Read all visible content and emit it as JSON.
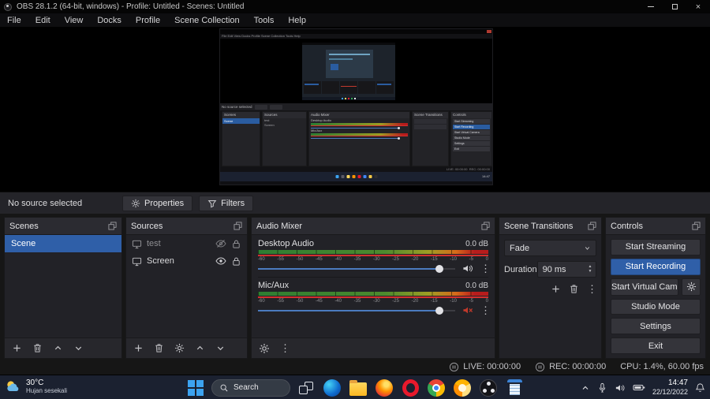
{
  "window": {
    "title": "OBS 28.1.2 (64-bit, windows) - Profile: Untitled - Scenes: Untitled"
  },
  "menu": {
    "items": [
      "File",
      "Edit",
      "View",
      "Docks",
      "Profile",
      "Scene Collection",
      "Tools",
      "Help"
    ],
    "joined": "File  Edit  View  Docks  Profile  Scene Collection  Tools  Help"
  },
  "source_toolbar": {
    "status": "No source selected",
    "properties": "Properties",
    "filters": "Filters"
  },
  "scenes": {
    "title": "Scenes",
    "items": [
      "Scene"
    ]
  },
  "sources": {
    "title": "Sources",
    "items": [
      {
        "name": "test",
        "visible": false,
        "locked": true
      },
      {
        "name": "Screen",
        "visible": true,
        "locked": true
      }
    ]
  },
  "mixer": {
    "title": "Audio Mixer",
    "channels": [
      {
        "name": "Desktop Audio",
        "db": "0.0 dB",
        "muted": false
      },
      {
        "name": "Mic/Aux",
        "db": "0.0 dB",
        "muted": true
      }
    ],
    "ticks": [
      "-60",
      "-55",
      "-50",
      "-45",
      "-40",
      "-35",
      "-30",
      "-25",
      "-20",
      "-15",
      "-10",
      "-5",
      "0"
    ]
  },
  "transitions": {
    "title": "Scene Transitions",
    "selected": "Fade",
    "duration_label": "Duration",
    "duration": "90 ms"
  },
  "controls": {
    "title": "Controls",
    "buttons": [
      "Start Streaming",
      "Start Recording",
      "Start Virtual Camera",
      "Studio Mode",
      "Settings",
      "Exit"
    ]
  },
  "status": {
    "live": "LIVE: 00:00:00",
    "rec": "REC: 00:00:00",
    "cpu": "CPU: 1.4%, 60.00 fps"
  },
  "taskbar": {
    "temp": "30°C",
    "weather": "Hujan sesekali",
    "search": "Search",
    "time": "14:47",
    "date": "22/12/2022"
  },
  "colors": {
    "accent": "#2f5fa8",
    "meter_red": "#d32f2f",
    "taskbar_bg": "#1b2130"
  }
}
